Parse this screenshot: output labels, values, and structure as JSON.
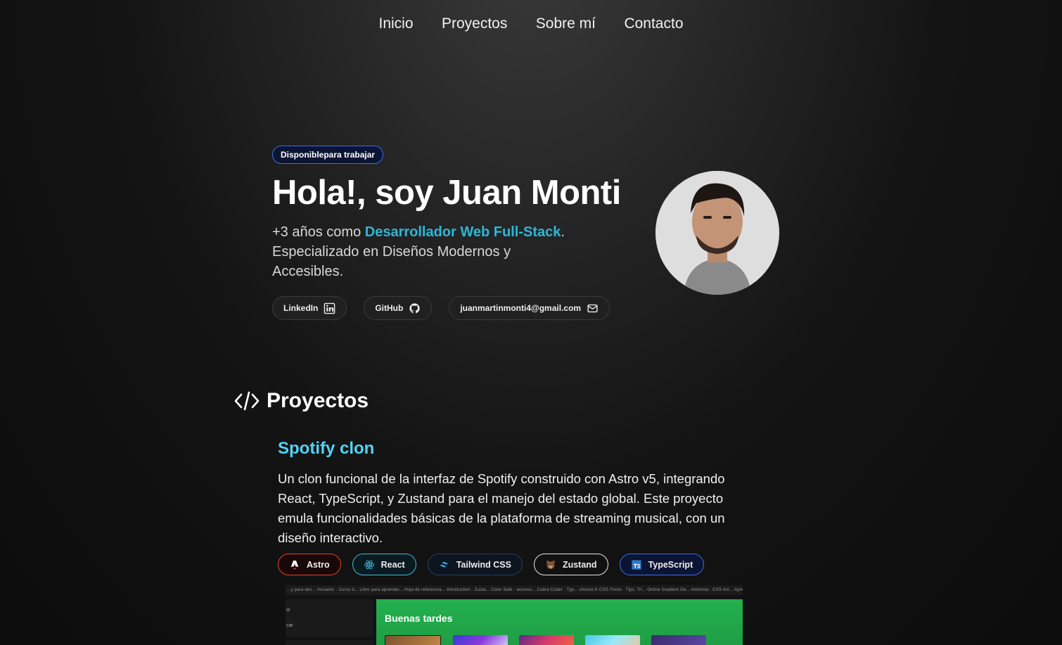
{
  "nav": {
    "items": [
      "Inicio",
      "Proyectos",
      "Sobre mí",
      "Contacto"
    ]
  },
  "hero": {
    "badge_a": "Disponible",
    "badge_b": "para trabajar",
    "title": "Hola!, soy Juan Monti",
    "desc_prefix": "+3 años como ",
    "desc_highlight": "Desarrollador Web Full-Stack",
    "desc_suffix": ". Especializado en Diseños Modernos y Accesibles.",
    "socials": {
      "linkedin": "LinkedIn",
      "github": "GitHub",
      "email": "juanmartinmonti4@gmail.com"
    }
  },
  "projects": {
    "title": "Proyectos",
    "items": [
      {
        "title": "Spotify clon",
        "description": "Un clon funcional de la interfaz de Spotify construido con Astro v5, integrando React, TypeScript, y Zustand para el manejo del estado global. Este proyecto emula funcionalidades básicas de la plataforma de streaming musical, con un diseño interactivo.",
        "tags": [
          "Astro",
          "React",
          "Tailwind CSS",
          "Zustand",
          "TypeScript"
        ],
        "preview": {
          "bookmarks": "...y para des...   Iniciador · Curso d...   Libro para aprender...   Hoja de referencia...   Introduction · Zusta...   Color Safe · accessi...   Cobra Coder · Typ...   chocoo.fr   CSS-Tricks · Tips, Tri...   Online Gradient Ge...   Animista · CSS Ani...   Aprende Java...",
          "side_1": "io",
          "side_2": "car",
          "greeting": "Buenas tardes"
        }
      }
    ]
  },
  "colors": {
    "accent_cyan": "#52d3f5",
    "highlight": "#2cb8d8",
    "badge_border": "#3b6fe0"
  }
}
